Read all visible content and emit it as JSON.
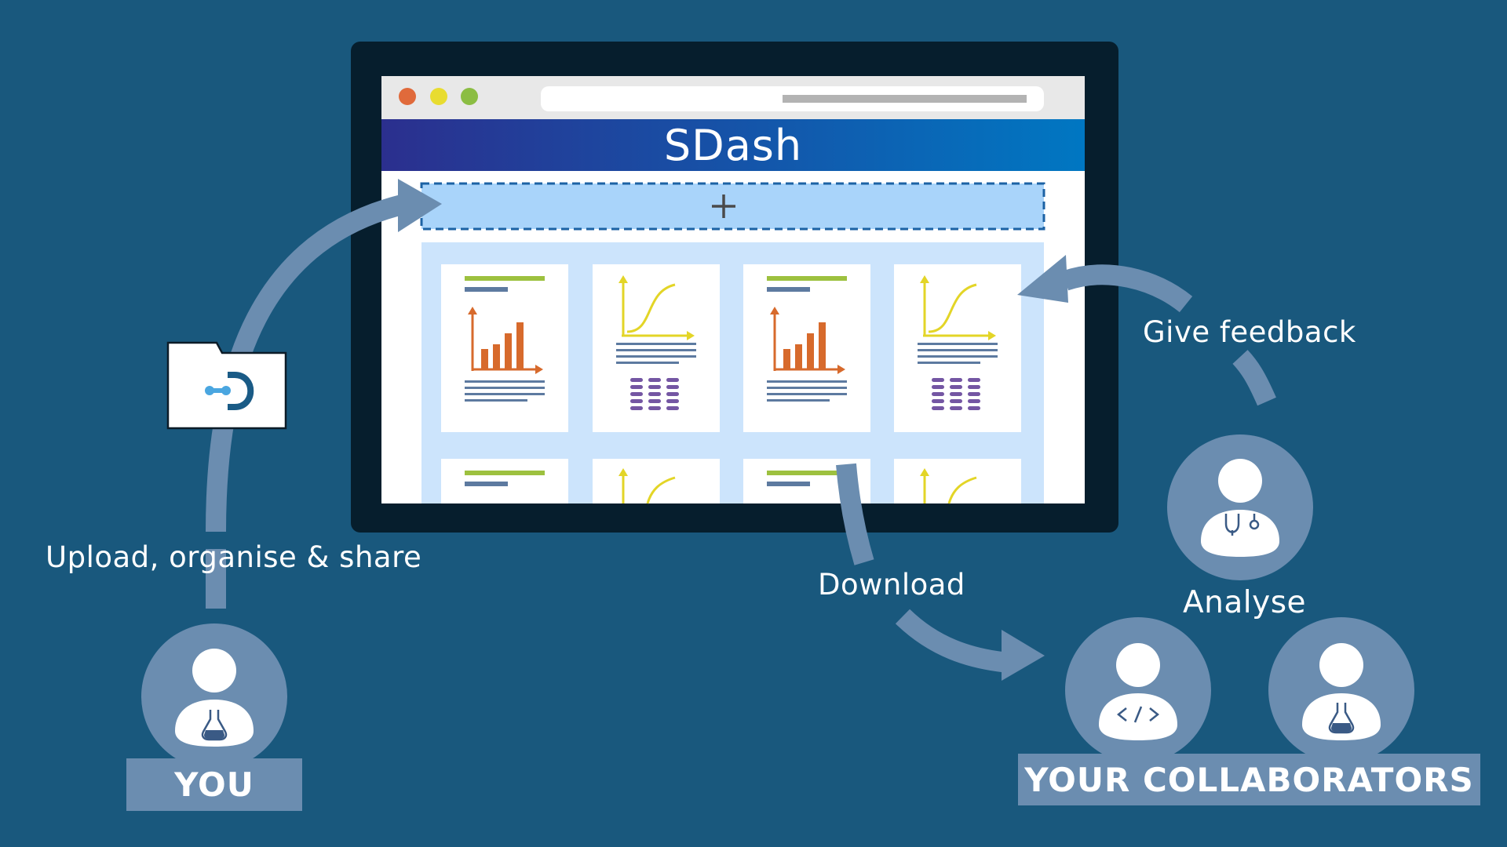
{
  "app": {
    "title": "SDash",
    "colors": {
      "background": "#19587d",
      "accent": "#6b8db0",
      "header_start": "#2b2f8e",
      "header_end": "#0077c2",
      "drop_zone": "#a9d4fa"
    }
  },
  "toolbar": {
    "add_icon": "plus-icon"
  },
  "labels": {
    "upload": "Upload, organise & share",
    "feedback": "Give feedback",
    "download": "Download",
    "analyse": "Analyse"
  },
  "people": {
    "you": {
      "label": "YOU",
      "icon": "flask-icon"
    },
    "collaborators": {
      "label": "YOUR COLLABORATORS",
      "icons": [
        "stethoscope-icon",
        "code-icon",
        "flask-icon"
      ]
    }
  },
  "icons": {
    "folder": "folder-icon",
    "logo": "sdash-logo-icon"
  }
}
